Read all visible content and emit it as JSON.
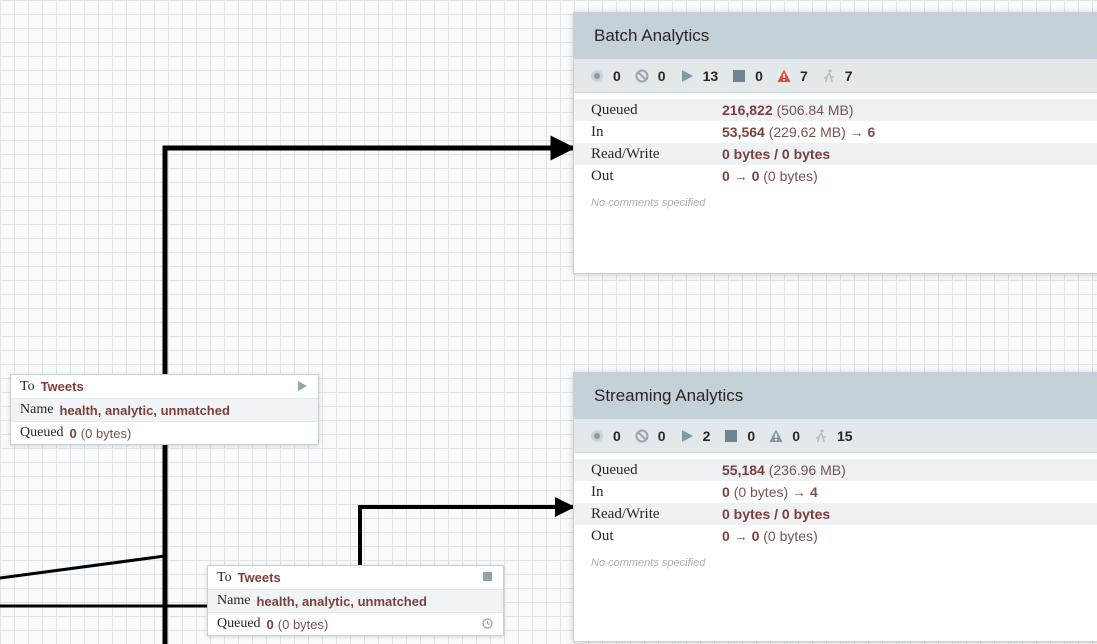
{
  "colors": {
    "canvas": "#f9fafb",
    "grid": "#dde3e6",
    "header": "#c5d1d8",
    "value": "#7d3f3c",
    "link": "#000000",
    "warning": "#e24b36"
  },
  "process_groups": [
    {
      "name": "Batch Analytics",
      "stats": {
        "transmitting": "0",
        "not_transmitting": "0",
        "running": "13",
        "stopped": "0",
        "invalid": "7",
        "disabled": "7"
      },
      "icons": [
        "transmitting-icon",
        "not-transmitting-icon",
        "running-icon",
        "stopped-icon",
        "invalid-warning-icon",
        "disabled-icon"
      ],
      "rows": [
        {
          "label": "Queued",
          "value": "216,822",
          "detail": "(506.84 MB)",
          "suffix": ""
        },
        {
          "label": "In",
          "value": "53,564",
          "detail": "(229.62 MB)",
          "suffix": "6"
        },
        {
          "label": "Read/Write",
          "value": "0 bytes / 0 bytes",
          "detail": "",
          "suffix": ""
        },
        {
          "label": "Out",
          "value": "0",
          "detail": "(0 bytes)",
          "suffix": "0"
        }
      ],
      "comments": "No comments specified"
    },
    {
      "name": "Streaming Analytics",
      "stats": {
        "transmitting": "0",
        "not_transmitting": "0",
        "running": "2",
        "stopped": "0",
        "invalid": "0",
        "disabled": "15"
      },
      "icons": [
        "transmitting-icon",
        "not-transmitting-icon",
        "running-icon",
        "stopped-icon",
        "invalid-warning-icon",
        "disabled-icon"
      ],
      "rows": [
        {
          "label": "Queued",
          "value": "55,184",
          "detail": "(236.96 MB)",
          "suffix": ""
        },
        {
          "label": "In",
          "value": "0",
          "detail": "(0 bytes)",
          "suffix": "4"
        },
        {
          "label": "Read/Write",
          "value": "0 bytes / 0 bytes",
          "detail": "",
          "suffix": ""
        },
        {
          "label": "Out",
          "value": "0",
          "detail": "(0 bytes)",
          "suffix": "0"
        }
      ],
      "comments": "No comments specified"
    }
  ],
  "connections": [
    {
      "to_label": "To",
      "to_value": "Tweets",
      "name_label": "Name",
      "name_value": "health, analytic, unmatched",
      "queued_label": "Queued",
      "queued_value": "0",
      "queued_detail": "(0 bytes)",
      "status_icon": "play-icon"
    },
    {
      "to_label": "To",
      "to_value": "Tweets",
      "name_label": "Name",
      "name_value": "health, analytic, unmatched",
      "queued_label": "Queued",
      "queued_value": "0",
      "queued_detail": "(0 bytes)",
      "status_icon": "stop-icon",
      "extra_icon": "clock-icon"
    }
  ],
  "arrow_glyph": "→"
}
